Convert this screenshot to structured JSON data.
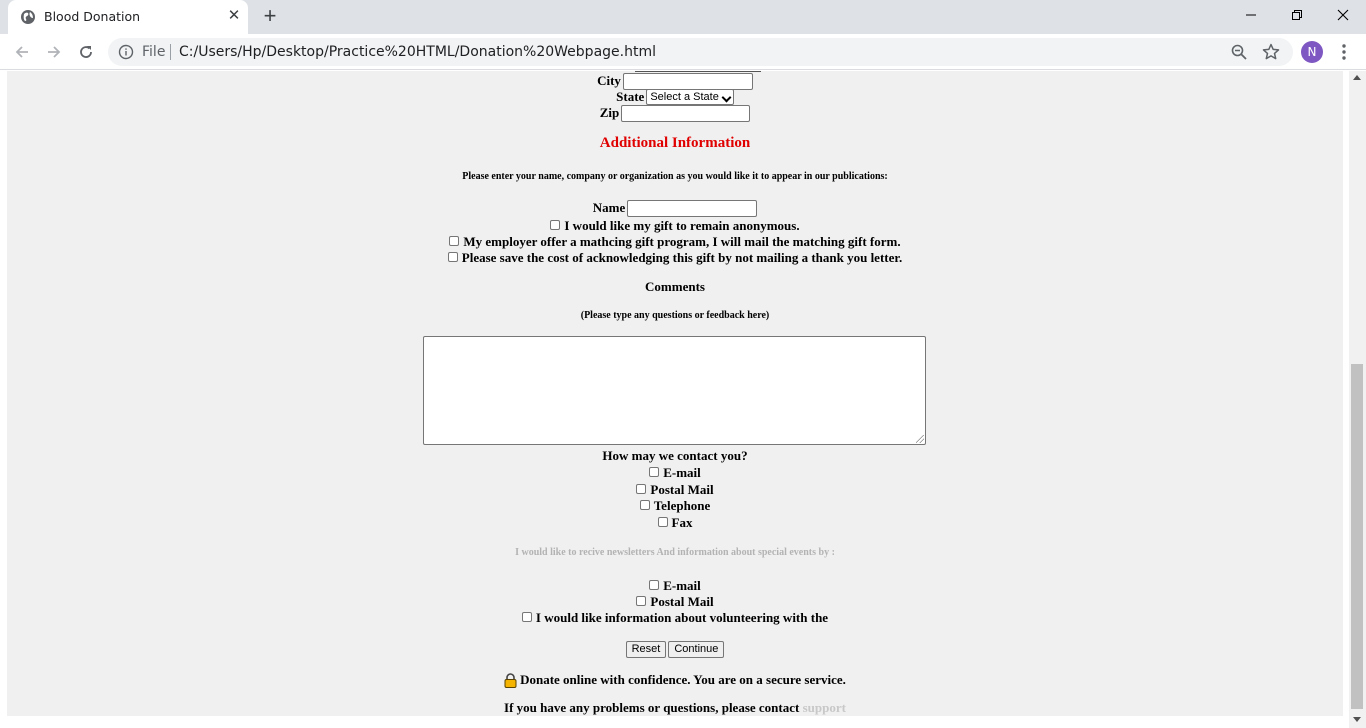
{
  "browser": {
    "tab_title": "Blood Donation",
    "scheme_label": "File",
    "url": "C:/Users/Hp/Desktop/Practice%20HTML/Donation%20Webpage.html",
    "profile_initial": "N"
  },
  "address": {
    "city_label": "City",
    "state_label": "State",
    "state_selected": "Select a State",
    "zip_label": "Zip"
  },
  "additional": {
    "heading": "Additional Information",
    "instruction": "Please enter your name, company or organization as you would like it to appear in our publications:",
    "name_label": "Name",
    "options": [
      "I would like my gift to remain anonymous.",
      "My employer offer a mathcing gift program, I will mail the matching gift form.",
      "Please save the cost of acknowledging this gift by not mailing a thank you letter."
    ]
  },
  "comments": {
    "heading": "Comments",
    "hint": "(Please type any questions or feedback here)"
  },
  "contact": {
    "question": "How may we contact you?",
    "options": [
      "E-mail",
      "Postal Mail",
      "Telephone",
      "Fax"
    ]
  },
  "newsletter": {
    "prompt": "I would like to recive newsletters And information about special events by :",
    "options": [
      "E-mail",
      "Postal Mail",
      "I would like information about volunteering with the"
    ]
  },
  "actions": {
    "reset_label": "Reset",
    "continue_label": "Continue"
  },
  "footer": {
    "secure_text": "Donate online with confidence. You are on a secure service.",
    "contact_text": "If you have any problems or questions, please contact",
    "support_link": "support"
  },
  "colors": {
    "heading_red": "#e00000",
    "avatar_purple": "#7e57c2",
    "page_background": "#f0f0f0"
  }
}
